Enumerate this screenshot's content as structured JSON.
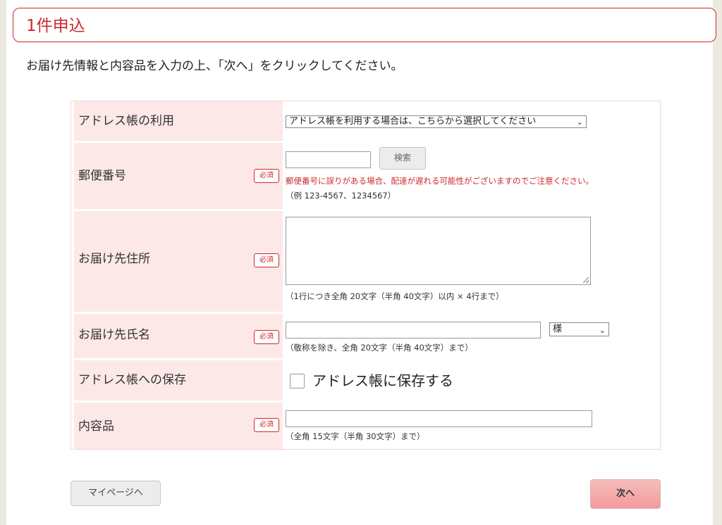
{
  "header": {
    "title": "1件申込"
  },
  "intro": "お届け先情報と内容品を入力の上、「次へ」をクリックしてください。",
  "required_label": "必須",
  "form": {
    "address_book": {
      "label": "アドレス帳の利用",
      "select_value": "アドレス帳を利用する場合は、こちらから選択してください"
    },
    "postal_code": {
      "label": "郵便番号",
      "value": "",
      "search_button": "検索",
      "warning": "郵便番号に誤りがある場合、配達が遅れる可能性がございますのでご注意ください。",
      "example": "（例 123-4567、1234567）"
    },
    "address": {
      "label": "お届け先住所",
      "value": "",
      "hint": "（1行につき全角 20文字（半角 40文字）以内 × 4行まで）"
    },
    "name": {
      "label": "お届け先氏名",
      "value": "",
      "honorific": "様",
      "hint": "（敬称を除き、全角 20文字（半角 40文字）まで）"
    },
    "save": {
      "label": "アドレス帳への保存",
      "checkbox_label": "アドレス帳に保存する",
      "checked": false
    },
    "contents": {
      "label": "内容品",
      "value": "",
      "hint": "（全角 15文字（半角 30文字）まで）"
    }
  },
  "buttons": {
    "mypage": "マイページへ",
    "next": "次へ"
  },
  "icons": {
    "dropdown": "chevron-down-icon",
    "resize": "resize-grip-icon"
  },
  "colors": {
    "accent": "#cc2a2a",
    "label_bg": "#fde8e8",
    "next_button": "#f29b9b"
  }
}
